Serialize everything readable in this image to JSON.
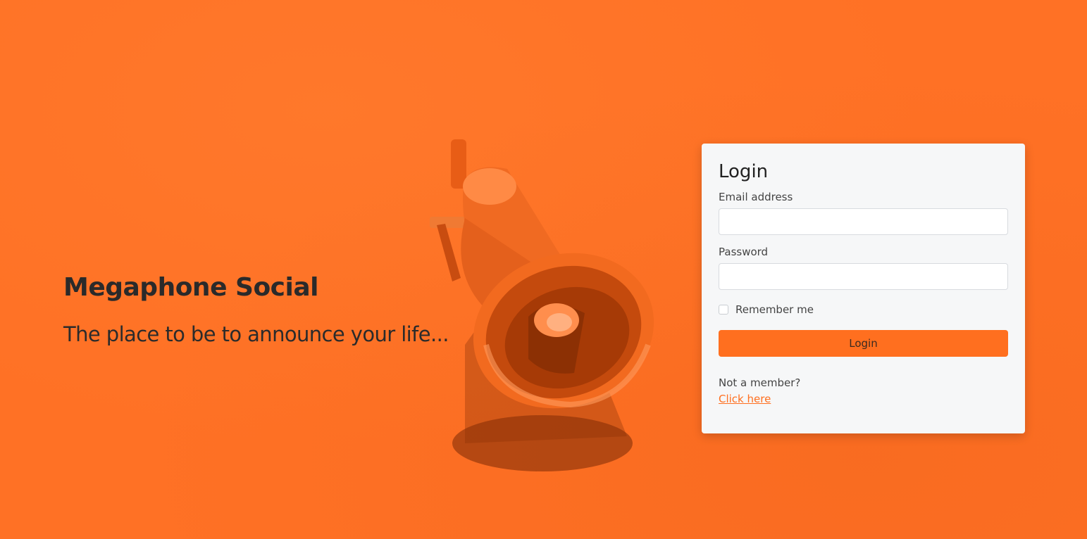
{
  "hero": {
    "title": "Megaphone Social",
    "tagline": "The place to be to announce your life..."
  },
  "login": {
    "heading": "Login",
    "email_label": "Email address",
    "email_value": "",
    "password_label": "Password",
    "password_value": "",
    "remember_label": "Remember me",
    "remember_checked": false,
    "submit_label": "Login",
    "signup_prompt": "Not a member?",
    "signup_link": "Click here"
  },
  "colors": {
    "background": "#ff7125",
    "accent": "#ff6f1f",
    "card": "#f6f7f8"
  },
  "illustration": {
    "icon": "megaphone-icon"
  }
}
